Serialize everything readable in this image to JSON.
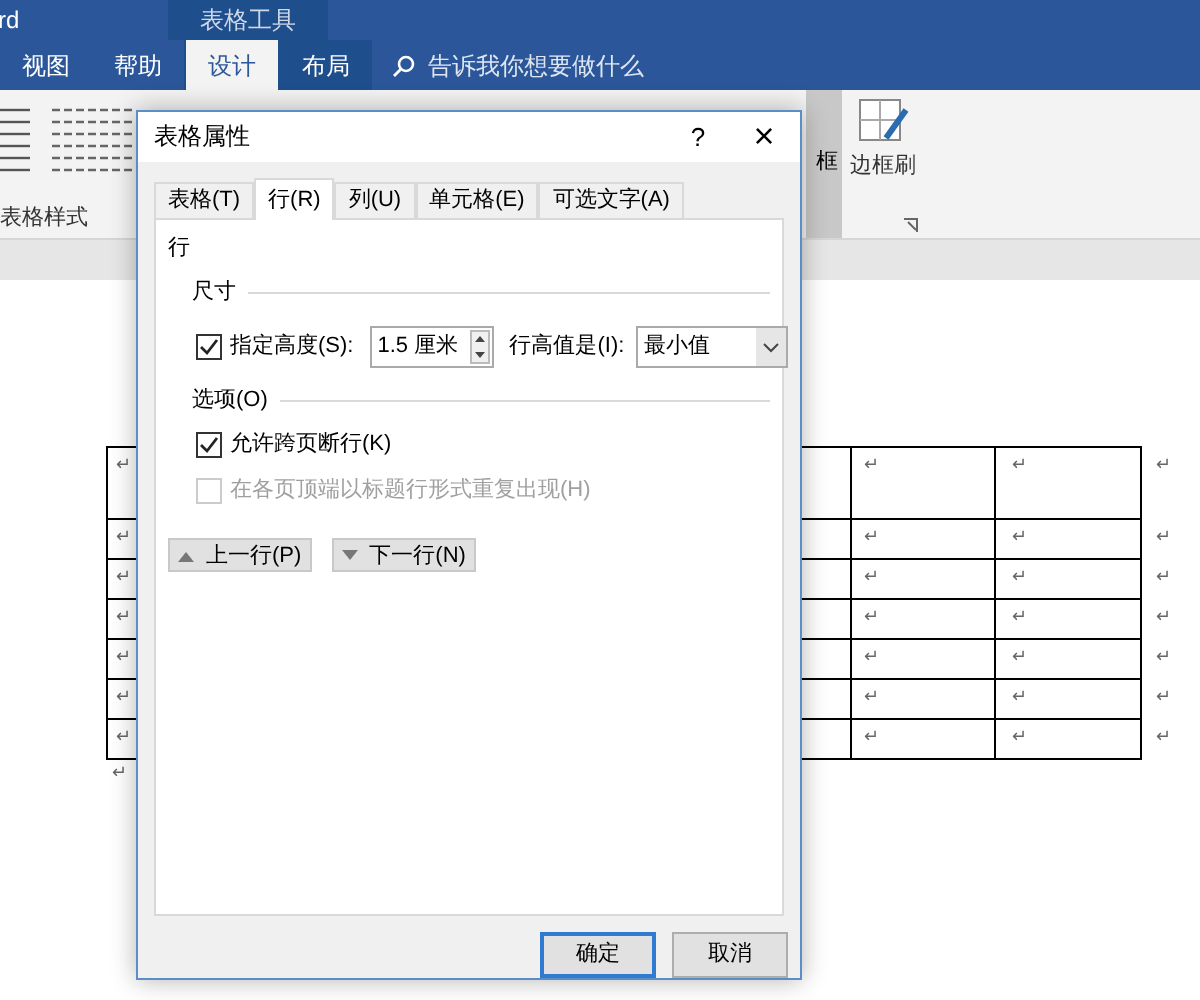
{
  "app_title": "rd",
  "context_tab_group": "表格工具",
  "ribbon_tabs": [
    {
      "label": "视图",
      "selected": false,
      "context": false
    },
    {
      "label": "帮助",
      "selected": false,
      "context": false
    },
    {
      "label": "设计",
      "selected": true,
      "context": true
    },
    {
      "label": "布局",
      "selected": false,
      "context": true
    }
  ],
  "tell_me": {
    "placeholder": "告诉我你想要做什么"
  },
  "ribbon": {
    "group_label": "表格样式",
    "border_button": "框",
    "border_painter": "边框刷"
  },
  "table": {
    "rows": [
      {
        "cells": [
          "↵",
          "↵",
          "↵"
        ],
        "end_mark": "↵"
      },
      {
        "cells": [
          "↵",
          "↵",
          "↵"
        ],
        "end_mark": "↵"
      },
      {
        "cells": [
          "↵",
          "↵",
          "↵"
        ],
        "end_mark": "↵"
      },
      {
        "cells": [
          "↵",
          "↵",
          "↵"
        ],
        "end_mark": "↵"
      },
      {
        "cells": [
          "↵",
          "↵",
          "↵"
        ],
        "end_mark": "↵"
      },
      {
        "cells": [
          "↵",
          "↵",
          "↵"
        ],
        "end_mark": "↵"
      },
      {
        "cells": [
          "↵",
          "↵",
          "↵"
        ],
        "end_mark": "↵"
      }
    ],
    "after_mark": "↵"
  },
  "dialog": {
    "title": "表格属性",
    "help": "?",
    "close": "×",
    "tabs": [
      {
        "label": "表格(T)",
        "selected": false
      },
      {
        "label": "行(R)",
        "selected": true
      },
      {
        "label": "列(U)",
        "selected": false
      },
      {
        "label": "单元格(E)",
        "selected": false
      },
      {
        "label": "可选文字(A)",
        "selected": false
      }
    ],
    "section": "行",
    "size_label": "尺寸",
    "specify_height": {
      "label": "指定高度(S):",
      "checked": true
    },
    "height_value": "1.5 厘米",
    "row_height_is": {
      "label": "行高值是(I):",
      "value": "最小值"
    },
    "options_label": "选项(O)",
    "options": [
      {
        "label": "允许跨页断行(K)",
        "checked": true,
        "disabled": false
      },
      {
        "label": "在各页顶端以标题行形式重复出现(H)",
        "checked": false,
        "disabled": true
      }
    ],
    "prev_row": "上一行(P)",
    "next_row": "下一行(N)",
    "ok": "确定",
    "cancel": "取消"
  }
}
